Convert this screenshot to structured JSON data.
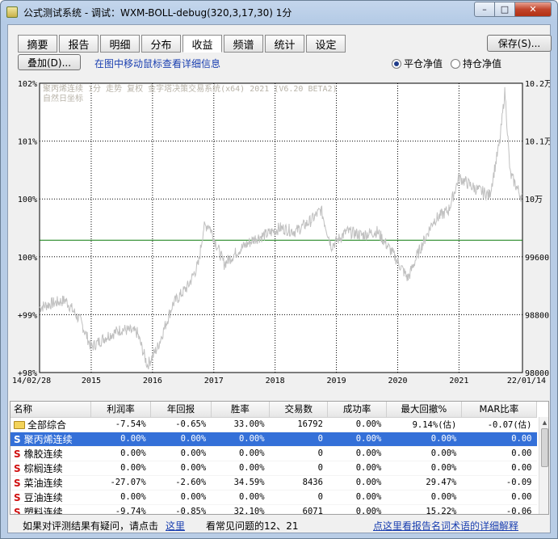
{
  "window": {
    "title": "公式测试系统 - 调试：WXM-BOLL-debug(320,3,17,30) 1分",
    "min_glyph": "–",
    "max_glyph": "□",
    "close_glyph": "✕"
  },
  "tabs": [
    {
      "label": "摘要",
      "active": false
    },
    {
      "label": "报告",
      "active": false
    },
    {
      "label": "明细",
      "active": false
    },
    {
      "label": "分布",
      "active": false
    },
    {
      "label": "收益",
      "active": true
    },
    {
      "label": "频谱",
      "active": false
    },
    {
      "label": "统计",
      "active": false
    },
    {
      "label": "设定",
      "active": false
    }
  ],
  "toolbar": {
    "save_label": "保存(S)...",
    "overlay_label": "叠加(D)...",
    "hint": "在图中移动鼠标查看详细信息",
    "radio_flat": "平仓净值",
    "radio_hold": "持仓净值",
    "radio_selected": "flat"
  },
  "chart_data": {
    "type": "line",
    "annotation": "聚丙烯连续 1分 走势 复权 金字塔决策交易系统(x64) 2021 (V6.20 BETA2) 自然日坐标",
    "y_left_ticks": [
      "102%",
      "101%",
      "100%",
      "100%",
      "+99%",
      "+98%"
    ],
    "y_right_ticks": [
      "10.2万",
      "10.1万",
      "10万",
      "99600",
      "98800",
      "98000"
    ],
    "x_ticks": [
      "14/02/28",
      "2015",
      "2016",
      "2017",
      "2018",
      "2019",
      "2020",
      "2021",
      "22/01/14"
    ],
    "baseline_value": 99830,
    "ylim": [
      98000,
      102000
    ],
    "series_color": "#c0c0c0",
    "baseline_color": "#0a7a0a",
    "approx_points": [
      [
        "14/02/28",
        98900
      ],
      [
        "2014-05",
        98950
      ],
      [
        "2014-08",
        99000
      ],
      [
        "2014-11",
        98700
      ],
      [
        "2015-01",
        98350
      ],
      [
        "2015-04",
        98500
      ],
      [
        "2015-07",
        98600
      ],
      [
        "2015-10",
        98550
      ],
      [
        "2015-12",
        98100
      ],
      [
        "2016-02",
        98350
      ],
      [
        "2016-05",
        98950
      ],
      [
        "2016-08",
        99200
      ],
      [
        "2016-10",
        99500
      ],
      [
        "2016-11",
        100000
      ],
      [
        "2016-12",
        100050
      ],
      [
        "2017-03",
        99500
      ],
      [
        "2017-06",
        99700
      ],
      [
        "2017-09",
        99850
      ],
      [
        "2017-11",
        99900
      ],
      [
        "2018-02",
        100000
      ],
      [
        "2018-05",
        99950
      ],
      [
        "2018-08",
        100100
      ],
      [
        "2018-10",
        100250
      ],
      [
        "2018-12",
        99750
      ],
      [
        "2019-03",
        99950
      ],
      [
        "2019-06",
        99900
      ],
      [
        "2019-09",
        99950
      ],
      [
        "2019-12",
        99650
      ],
      [
        "2020-03",
        99300
      ],
      [
        "2020-05",
        99650
      ],
      [
        "2020-08",
        100100
      ],
      [
        "2020-11",
        100250
      ],
      [
        "2021-01",
        100700
      ],
      [
        "2021-04",
        100550
      ],
      [
        "2021-07",
        100450
      ],
      [
        "2021-09",
        101200
      ],
      [
        "2021-10",
        101900
      ],
      [
        "2021-11",
        100750
      ],
      [
        "22/01/14",
        100400
      ]
    ]
  },
  "table": {
    "headers": [
      "名称",
      "利润率",
      "年回报",
      "胜率",
      "交易数",
      "成功率",
      "最大回撤%",
      "MAR比率"
    ],
    "rows": [
      {
        "type": "folder",
        "name": "全部综合",
        "cells": [
          "-7.54%",
          "-0.65%",
          "33.00%",
          "16792",
          "0.00%",
          "9.14%(估)",
          "-0.07(估)"
        ],
        "selected": false
      },
      {
        "type": "s",
        "name": "聚丙烯连续",
        "cells": [
          "0.00%",
          "0.00%",
          "0.00%",
          "0",
          "0.00%",
          "0.00%",
          "0.00"
        ],
        "selected": true
      },
      {
        "type": "s",
        "name": "橡胶连续",
        "cells": [
          "0.00%",
          "0.00%",
          "0.00%",
          "0",
          "0.00%",
          "0.00%",
          "0.00"
        ],
        "selected": false
      },
      {
        "type": "s",
        "name": "棕榈连续",
        "cells": [
          "0.00%",
          "0.00%",
          "0.00%",
          "0",
          "0.00%",
          "0.00%",
          "0.00"
        ],
        "selected": false
      },
      {
        "type": "s",
        "name": "菜油连续",
        "cells": [
          "-27.07%",
          "-2.60%",
          "34.59%",
          "8436",
          "0.00%",
          "29.47%",
          "-0.09"
        ],
        "selected": false
      },
      {
        "type": "s",
        "name": "豆油连续",
        "cells": [
          "0.00%",
          "0.00%",
          "0.00%",
          "0",
          "0.00%",
          "0.00%",
          "0.00"
        ],
        "selected": false
      },
      {
        "type": "s",
        "name": "塑料连续",
        "cells": [
          "-9.74%",
          "-0.85%",
          "32.10%",
          "6071",
          "0.00%",
          "15.22%",
          "-0.06"
        ],
        "selected": false
      }
    ],
    "s_marker": "S"
  },
  "footer": {
    "question_text": "如果对评测结果有疑问，请点击",
    "here_link": "这里",
    "faq_text": "看常见问题的12、21",
    "glossary_link": "点这里看报告名词术语的详细解释"
  }
}
